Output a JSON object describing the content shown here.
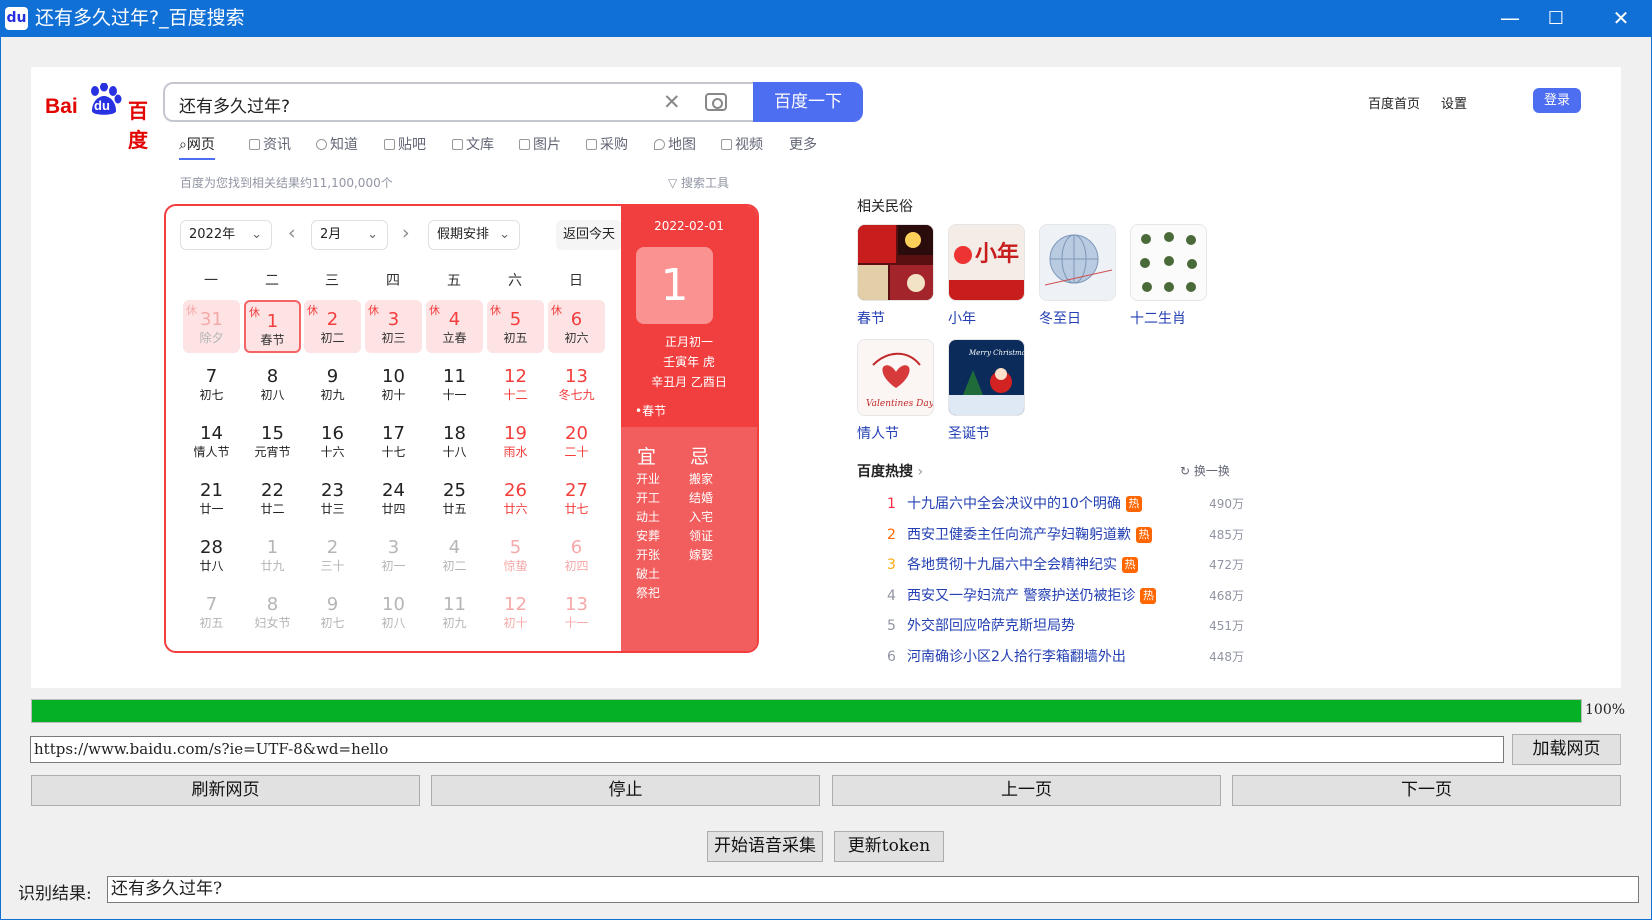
{
  "window": {
    "title": "还有多久过年?_百度搜索",
    "app_icon": "baidu-paw-icon",
    "icon_text": "du"
  },
  "browser": {
    "logo": {
      "bai": "Bai",
      "du": "du",
      "baidu": "百度"
    },
    "search": {
      "query": "还有多久过年?",
      "button": "百度一下"
    },
    "top_links": [
      "百度首页",
      "设置"
    ],
    "login": "登录",
    "tabs": [
      "网页",
      "资讯",
      "知道",
      "贴吧",
      "文库",
      "图片",
      "采购",
      "地图",
      "视频",
      "更多"
    ],
    "result_count": "百度为您找到相关结果约11,100,000个",
    "search_tools": "搜索工具",
    "calendar": {
      "year": "2022年",
      "month": "2月",
      "holiday_select": "假期安排",
      "back_today": "返回今天",
      "weekdays": [
        "一",
        "二",
        "三",
        "四",
        "五",
        "六",
        "日"
      ],
      "rest_mark": "休",
      "rows": [
        [
          [
            "31",
            "除夕"
          ],
          [
            "1",
            "春节"
          ],
          [
            "2",
            "初二"
          ],
          [
            "3",
            "初三"
          ],
          [
            "4",
            "立春"
          ],
          [
            "5",
            "初五"
          ],
          [
            "6",
            "初六"
          ]
        ],
        [
          [
            "7",
            "初七"
          ],
          [
            "8",
            "初八"
          ],
          [
            "9",
            "初九"
          ],
          [
            "10",
            "初十"
          ],
          [
            "11",
            "十一"
          ],
          [
            "12",
            "十二"
          ],
          [
            "13",
            "冬七九"
          ]
        ],
        [
          [
            "14",
            "情人节"
          ],
          [
            "15",
            "元宵节"
          ],
          [
            "16",
            "十六"
          ],
          [
            "17",
            "十七"
          ],
          [
            "18",
            "十八"
          ],
          [
            "19",
            "雨水"
          ],
          [
            "20",
            "二十"
          ]
        ],
        [
          [
            "21",
            "廿一"
          ],
          [
            "22",
            "廿二"
          ],
          [
            "23",
            "廿三"
          ],
          [
            "24",
            "廿四"
          ],
          [
            "25",
            "廿五"
          ],
          [
            "26",
            "廿六"
          ],
          [
            "27",
            "廿七"
          ]
        ],
        [
          [
            "28",
            "廿八"
          ],
          [
            "1",
            "廿九"
          ],
          [
            "2",
            "三十"
          ],
          [
            "3",
            "初一"
          ],
          [
            "4",
            "初二"
          ],
          [
            "5",
            "惊蛰"
          ],
          [
            "6",
            "初四"
          ]
        ],
        [
          [
            "7",
            "初五"
          ],
          [
            "8",
            "妇女节"
          ],
          [
            "9",
            "初七"
          ],
          [
            "10",
            "初八"
          ],
          [
            "11",
            "初九"
          ],
          [
            "12",
            "初十"
          ],
          [
            "13",
            "十一"
          ]
        ]
      ],
      "detail": {
        "date": "2022-02-01",
        "day": "1",
        "lunar": "正月初一",
        "ganzhi_year": "壬寅年 虎",
        "ganzhi_month_day": "辛丑月 乙酉日",
        "festival": "•春节",
        "yi": "宜",
        "ji": "忌",
        "yi_items": [
          "开业",
          "开工",
          "动土",
          "安葬",
          "开张",
          "破土",
          "祭祀"
        ],
        "ji_items": [
          "搬家",
          "结婚",
          "入宅",
          "领证",
          "嫁娶"
        ]
      }
    },
    "related": {
      "title": "相关民俗",
      "items": [
        "春节",
        "小年",
        "冬至日",
        "十二生肖",
        "情人节",
        "圣诞节"
      ],
      "thumb_text": {
        "xiaonian": "小年",
        "valentine": "Valentines Day",
        "xmas": "Merry Christmas"
      }
    },
    "hot": {
      "title": "百度热搜",
      "refresh": "换一换",
      "tag": "热",
      "items": [
        {
          "rank": "1",
          "title": "十九届六中全会决议中的10个明确",
          "count": "490万",
          "hot": true
        },
        {
          "rank": "2",
          "title": "西安卫健委主任向流产孕妇鞠躬道歉",
          "count": "485万",
          "hot": true
        },
        {
          "rank": "3",
          "title": "各地贯彻十九届六中全会精神纪实",
          "count": "472万",
          "hot": true
        },
        {
          "rank": "4",
          "title": "西安又一孕妇流产 警察护送仍被拒诊",
          "count": "468万",
          "hot": true
        },
        {
          "rank": "5",
          "title": "外交部回应哈萨克斯坦局势",
          "count": "451万",
          "hot": false
        },
        {
          "rank": "6",
          "title": "河南确诊小区2人拾行李箱翻墙外出",
          "count": "448万",
          "hot": false
        }
      ]
    }
  },
  "progress": {
    "value": 1.0,
    "label": "100%"
  },
  "url_bar": {
    "value": "https://www.baidu.com/s?ie=UTF-8&wd=hello"
  },
  "buttons": {
    "load": "加载网页",
    "refresh": "刷新网页",
    "stop": "停止",
    "prev": "上一页",
    "next": "下一页",
    "voice": "开始语音采集",
    "token": "更新token"
  },
  "result": {
    "label": "识别结果:",
    "value": "还有多久过年?"
  },
  "colors": {
    "titlebar": "#1170d6",
    "accent": "#4e6ef2",
    "calendar_red": "#f13e3e",
    "progress": "#06b025"
  }
}
